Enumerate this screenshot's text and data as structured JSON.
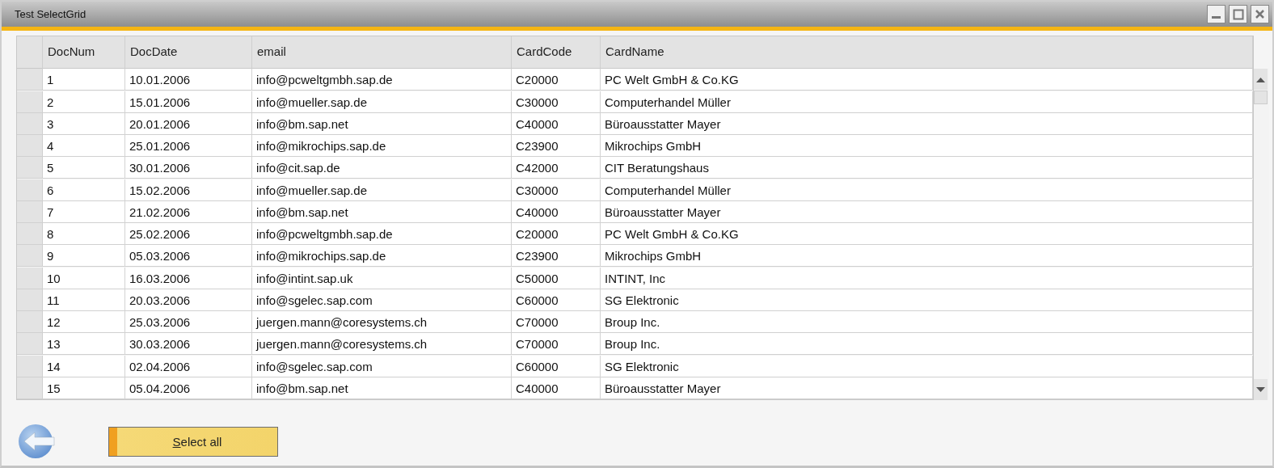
{
  "window": {
    "title": "Test SelectGrid"
  },
  "table": {
    "columns": [
      "DocNum",
      "DocDate",
      "email",
      "CardCode",
      "CardName"
    ],
    "rows": [
      [
        "1",
        "10.01.2006",
        "info@pcweltgmbh.sap.de",
        "C20000",
        "PC Welt GmbH & Co.KG"
      ],
      [
        "2",
        "15.01.2006",
        "info@mueller.sap.de",
        "C30000",
        "Computerhandel Müller"
      ],
      [
        "3",
        "20.01.2006",
        "info@bm.sap.net",
        "C40000",
        "Büroausstatter Mayer"
      ],
      [
        "4",
        "25.01.2006",
        "info@mikrochips.sap.de",
        "C23900",
        "Mikrochips GmbH"
      ],
      [
        "5",
        "30.01.2006",
        "info@cit.sap.de",
        "C42000",
        "CIT Beratungshaus"
      ],
      [
        "6",
        "15.02.2006",
        "info@mueller.sap.de",
        "C30000",
        "Computerhandel Müller"
      ],
      [
        "7",
        "21.02.2006",
        "info@bm.sap.net",
        "C40000",
        "Büroausstatter Mayer"
      ],
      [
        "8",
        "25.02.2006",
        "info@pcweltgmbh.sap.de",
        "C20000",
        "PC Welt GmbH & Co.KG"
      ],
      [
        "9",
        "05.03.2006",
        "info@mikrochips.sap.de",
        "C23900",
        "Mikrochips GmbH"
      ],
      [
        "10",
        "16.03.2006",
        "info@intint.sap.uk",
        "C50000",
        "INTINT, Inc"
      ],
      [
        "11",
        "20.03.2006",
        "info@sgelec.sap.com",
        "C60000",
        "SG Elektronic"
      ],
      [
        "12",
        "25.03.2006",
        "juergen.mann@coresystems.ch",
        "C70000",
        "Broup Inc."
      ],
      [
        "13",
        "30.03.2006",
        "juergen.mann@coresystems.ch",
        "C70000",
        "Broup Inc."
      ],
      [
        "14",
        "02.04.2006",
        "info@sgelec.sap.com",
        "C60000",
        "SG Elektronic"
      ],
      [
        "15",
        "05.04.2006",
        "info@bm.sap.net",
        "C40000",
        "Büroausstatter Mayer"
      ]
    ]
  },
  "buttons": [
    {
      "label": "Select all"
    }
  ]
}
